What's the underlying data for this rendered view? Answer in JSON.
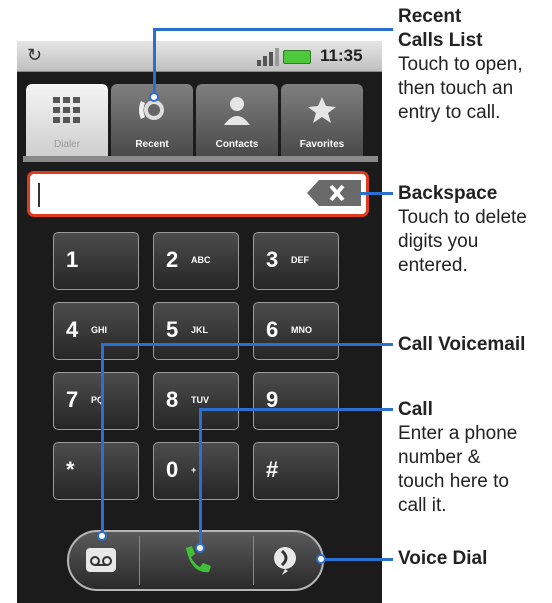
{
  "status": {
    "time": "11:35"
  },
  "tabs": [
    {
      "label": "Dialer",
      "icon": "keypad-icon",
      "active": true
    },
    {
      "label": "Recent",
      "icon": "recent-calls-icon",
      "active": false
    },
    {
      "label": "Contacts",
      "icon": "contact-icon",
      "active": false
    },
    {
      "label": "Favorites",
      "icon": "star-icon",
      "active": false
    }
  ],
  "dial_field": {
    "value": ""
  },
  "keys": [
    {
      "digit": "1",
      "letters": ""
    },
    {
      "digit": "2",
      "letters": "ABC"
    },
    {
      "digit": "3",
      "letters": "DEF"
    },
    {
      "digit": "4",
      "letters": "GHI"
    },
    {
      "digit": "5",
      "letters": "JKL"
    },
    {
      "digit": "6",
      "letters": "MNO"
    },
    {
      "digit": "7",
      "letters": "PQ"
    },
    {
      "digit": "8",
      "letters": "TUV"
    },
    {
      "digit": "9",
      "letters": ""
    },
    {
      "digit": "*",
      "letters": ""
    },
    {
      "digit": "0",
      "letters": "+"
    },
    {
      "digit": "#",
      "letters": ""
    }
  ],
  "annotations": {
    "recent": {
      "title1": "Recent",
      "title2": "Calls List",
      "l1": "Touch to open,",
      "l2": "then touch an",
      "l3": "entry to call."
    },
    "backspace": {
      "title": "Backspace",
      "l1": "Touch to delete",
      "l2": "digits you",
      "l3": "entered."
    },
    "voicemail": {
      "title": "Call Voicemail"
    },
    "call": {
      "title": "Call",
      "l1": "Enter a phone",
      "l2": "number &",
      "l3": "touch here to",
      "l4": "call it."
    },
    "voicedial": {
      "title": "Voice Dial"
    }
  },
  "colors": {
    "accent_red": "#e03b1e",
    "callout_blue": "#2b6fd1",
    "call_green": "#3fbf3a"
  }
}
